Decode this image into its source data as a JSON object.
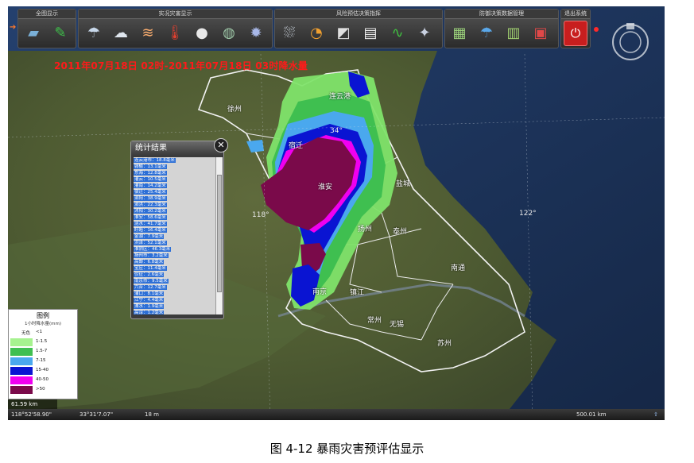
{
  "toolbar": {
    "groups": [
      {
        "title": "全图显示",
        "buttons": [
          {
            "icon": "terrain-layers-icon"
          },
          {
            "icon": "green-tool-icon"
          }
        ]
      },
      {
        "title": "实况灾害显示",
        "buttons": [
          {
            "icon": "weather-station-icon"
          },
          {
            "icon": "cloud-icon"
          },
          {
            "icon": "wind-icon"
          },
          {
            "icon": "thermometer-icon"
          },
          {
            "icon": "hail-icon"
          },
          {
            "icon": "globe-icon"
          },
          {
            "icon": "storm-icon"
          }
        ]
      },
      {
        "title": "风险预估决策指挥",
        "buttons": [
          {
            "icon": "rain-cloud-icon"
          },
          {
            "icon": "pie-chart-icon"
          },
          {
            "icon": "ruler-icon"
          },
          {
            "icon": "paper-icon"
          },
          {
            "icon": "wave-chart-icon"
          },
          {
            "icon": "satellite-icon"
          }
        ]
      },
      {
        "title": "防御决策数据管理",
        "buttons": [
          {
            "icon": "document-icon"
          },
          {
            "icon": "umbrella-icon"
          },
          {
            "icon": "notebook-icon"
          },
          {
            "icon": "calendar-icon"
          }
        ]
      },
      {
        "title": "退出系统",
        "buttons": [
          {
            "icon": "power-icon"
          }
        ]
      }
    ],
    "colors": {
      "power": "#d42020"
    }
  },
  "map": {
    "title": "2011年07月18日 02时-2011年07月18日 03时降水量",
    "cities": [
      {
        "name": "连云港"
      },
      {
        "name": "徐州"
      },
      {
        "name": "宿迁"
      },
      {
        "name": "淮安"
      },
      {
        "name": "盐城"
      },
      {
        "name": "扬州"
      },
      {
        "name": "泰州"
      },
      {
        "name": "南京"
      },
      {
        "name": "镇江"
      },
      {
        "name": "常州"
      },
      {
        "name": "南通"
      },
      {
        "name": "无锡"
      },
      {
        "name": "苏州"
      }
    ],
    "marker_34": "34°",
    "lon_118": "118°",
    "lon_122": "122°",
    "colors": {
      "lt15": "#7fe36a",
      "c15_7": "#3fbf50",
      "c7_15": "#4aa8ee",
      "c15_40": "#0a14d2",
      "c40_50": "#f000f0",
      "gt50": "#7a0a4a"
    }
  },
  "stats": {
    "title": "统计结果",
    "close": "✕",
    "rows": [
      "连云港市：18.8毫米",
      "赣榆：13.1毫米",
      "东海：12.8毫米",
      "灌云：10.5毫米",
      "灌南：14.2毫米",
      "宿迁：25.4毫米",
      "泗阳：38.9毫米",
      "泗洪：22.3毫米",
      "沭阳：30.2毫米",
      "淮安：58.6毫米",
      "涟水：41.7毫米",
      "盱眙：16.4毫米",
      "金湖：7.9毫米",
      "洪泽：52.1毫米",
      "淮阴区：46.3毫米",
      "扬州市：3.2毫米",
      "高邮：6.8毫米",
      "宝应：11.4毫米",
      "仪征：2.6毫米",
      "南京市：9.5毫米",
      "六合：12.7毫米",
      "浦口：8.1毫米",
      "江宁：4.4毫米",
      "溧水：1.9毫米",
      "高淳：1.2毫米",
      "镇江市：2.2毫米",
      "句容：1.6毫米",
      "丹阳：1.1毫米"
    ]
  },
  "legend": {
    "title": "图例",
    "subtitle": "1小时降水量(mm)",
    "none_label": "无色",
    "items": [
      {
        "label": "<1",
        "color": "#ffffff"
      },
      {
        "label": "1-1.5",
        "color": "#a6f28f"
      },
      {
        "label": "1.5-7",
        "color": "#3fbf50"
      },
      {
        "label": "7-15",
        "color": "#4aa8ee"
      },
      {
        "label": "15-40",
        "color": "#0a14d2"
      },
      {
        "label": "40-50",
        "color": "#f000f0"
      },
      {
        "label": ">50",
        "color": "#7a0a4a"
      }
    ]
  },
  "status": {
    "scale": "61.59 km",
    "coord_a": "118°52'58.90\"",
    "coord_b": "33°31'7.07\"",
    "elev": "18 m",
    "range": "500.01 km"
  },
  "caption": "图 4-12 暴雨灾害预评估显示"
}
